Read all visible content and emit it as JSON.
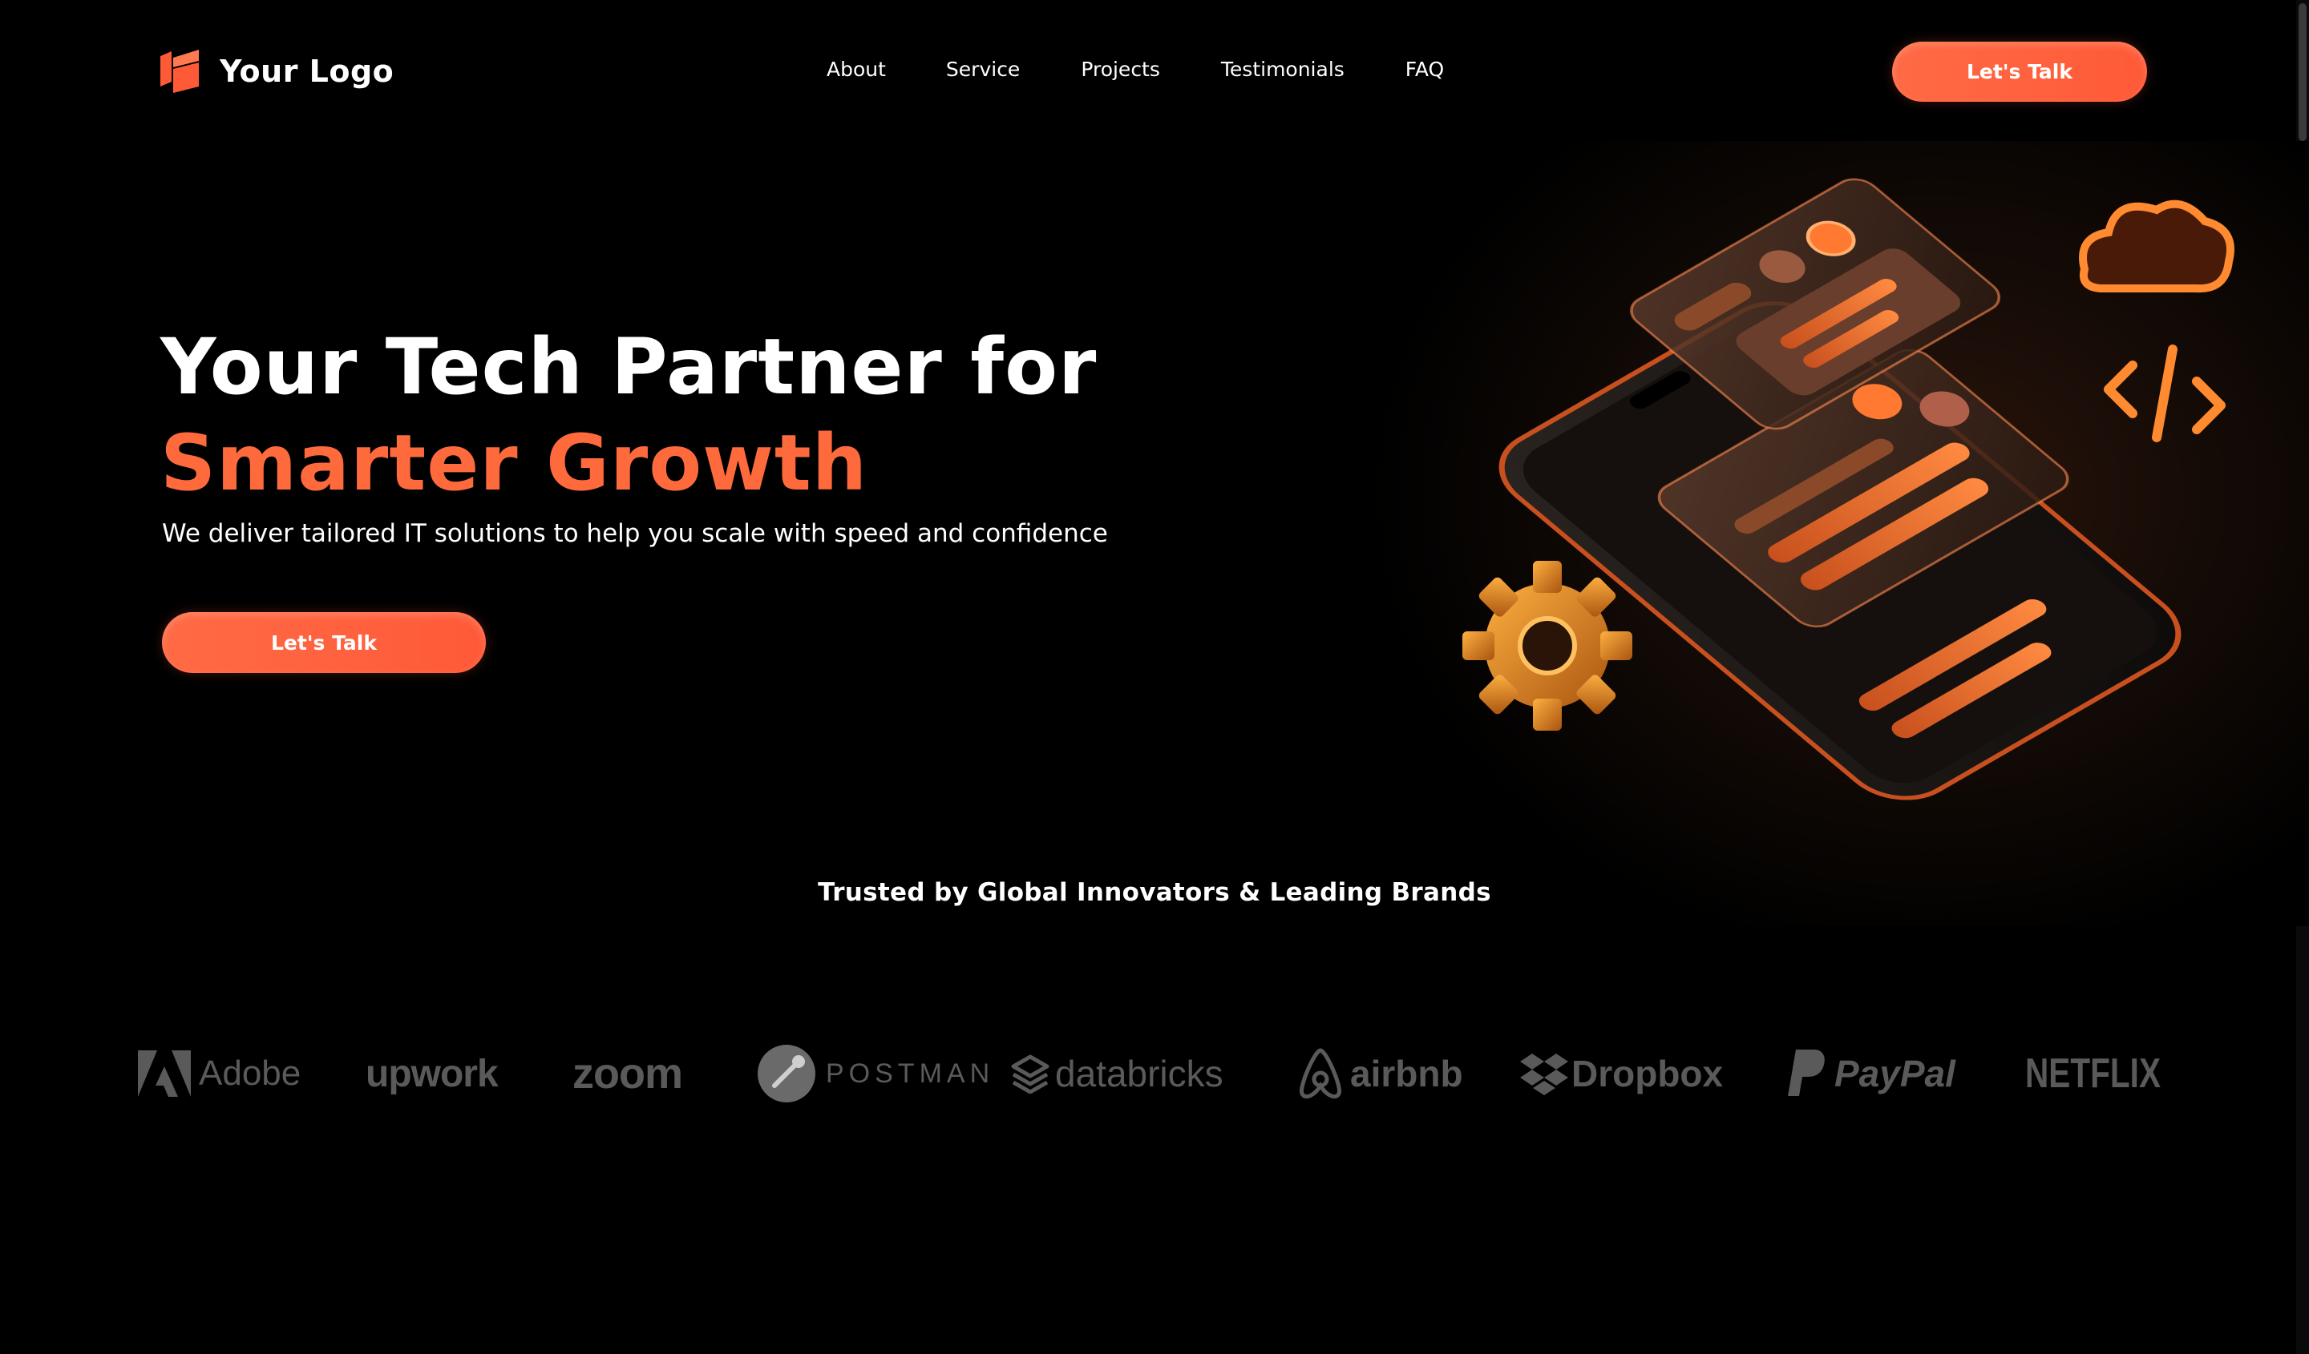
{
  "nav": {
    "logo_text": "Your Logo",
    "links": [
      {
        "label": "About"
      },
      {
        "label": "Service"
      },
      {
        "label": "Projects"
      },
      {
        "label": "Testimonials"
      },
      {
        "label": "FAQ"
      }
    ],
    "cta_label": "Let's Talk"
  },
  "hero": {
    "title_line1": "Your Tech Partner for",
    "title_line2": "Smarter Growth",
    "subtitle": "We deliver tailored IT solutions to help you scale with speed and confidence",
    "cta_label": "Let's Talk"
  },
  "trusted": {
    "heading": "Trusted by Global Innovators & Leading Brands",
    "brands": [
      {
        "name": "Adobe",
        "icon": "adobe-icon"
      },
      {
        "name": "upwork",
        "icon": "none"
      },
      {
        "name": "zoom",
        "icon": "none"
      },
      {
        "name": "POSTMAN",
        "icon": "postman-icon"
      },
      {
        "name": "databricks",
        "icon": "databricks-icon"
      },
      {
        "name": "airbnb",
        "icon": "airbnb-icon"
      },
      {
        "name": "Dropbox",
        "icon": "dropbox-icon"
      },
      {
        "name": "PayPal",
        "icon": "paypal-icon"
      },
      {
        "name": "NETFLIX",
        "icon": "none"
      }
    ]
  },
  "colors": {
    "accent": "#ff6a3d",
    "background": "#000000",
    "brand_logo_gray": "#5a5a5a"
  }
}
